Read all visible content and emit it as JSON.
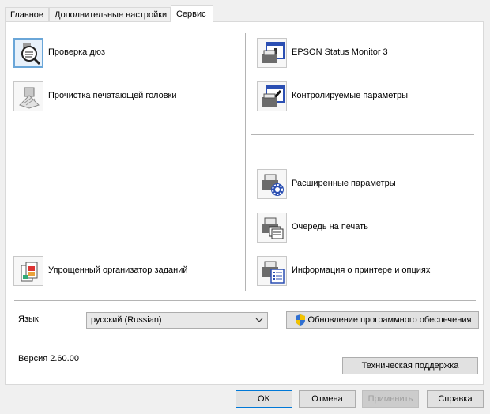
{
  "tabs": [
    {
      "label": "Главное"
    },
    {
      "label": "Дополнительные настройки"
    },
    {
      "label": "Сервис",
      "active": true
    }
  ],
  "left_items": [
    {
      "label": "Проверка дюз",
      "icon": "nozzle-check-icon"
    },
    {
      "label": "Прочистка печатающей головки",
      "icon": "head-cleaning-icon"
    },
    {
      "label": "Упрощенный организатор заданий",
      "icon": "job-arranger-icon"
    }
  ],
  "right_items": [
    {
      "label": "EPSON Status Monitor 3",
      "icon": "status-monitor-icon"
    },
    {
      "label": "Контролируемые параметры",
      "icon": "monitoring-preferences-icon"
    },
    {
      "label": "Расширенные параметры",
      "icon": "extended-settings-icon"
    },
    {
      "label": "Очередь на печать",
      "icon": "print-queue-icon"
    },
    {
      "label": "Информация о принтере и опциях",
      "icon": "printer-info-icon"
    }
  ],
  "language": {
    "label": "Язык",
    "value": "русский (Russian)"
  },
  "update_button": "Обновление программного обеспечения",
  "version": "Версия 2.60.00",
  "support_button": "Техническая поддержка",
  "buttons": {
    "ok": "OK",
    "cancel": "Отмена",
    "apply": "Применить",
    "help": "Справка"
  },
  "colors": {
    "focus": "#6aa6d8",
    "accent": "#0078d7",
    "panel": "#ffffff",
    "window": "#f0f0f0"
  }
}
